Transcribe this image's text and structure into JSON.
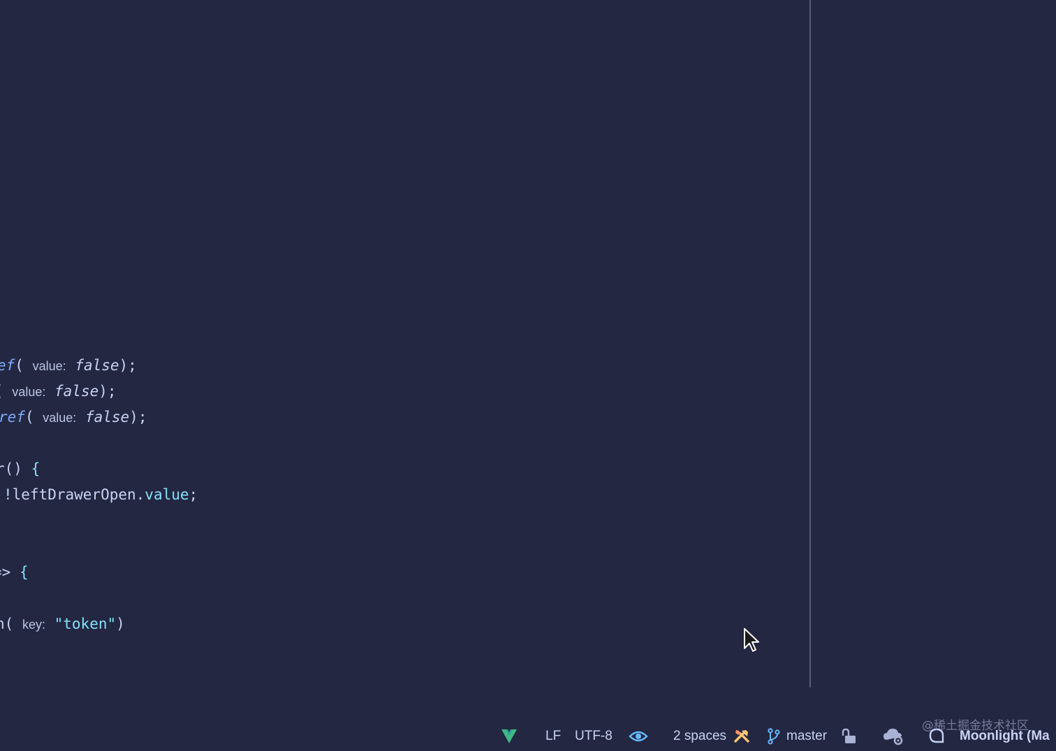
{
  "code": {
    "line1": {
      "prefix": "ef",
      "open": "(",
      "hint": "value:",
      "val": "false",
      "close": ");"
    },
    "line2": {
      "prefix": "(",
      "hint": "value:",
      "val": "false",
      "close": ");"
    },
    "line3": {
      "prefix": "ref",
      "open": "(",
      "hint": "value:",
      "val": "false",
      "close": ");"
    },
    "line4": {
      "prefix": "r()",
      "brace": "{"
    },
    "line5": {
      "text": "!leftDrawerOpen.",
      "prop": "value",
      "end": ";"
    },
    "line6": {
      "prefix": "=>",
      "brace": "{"
    },
    "line7": {
      "prefix": "n(",
      "hint": "key:",
      "str": "\"token\"",
      "close": ")"
    }
  },
  "statusbar": {
    "vue_icon": "vue-icon",
    "line_ending": "LF",
    "encoding": "UTF-8",
    "eye_icon": "eye-icon",
    "indent": "2 spaces",
    "tools_icon": "tools-icon",
    "branch_icon": "git-branch-icon",
    "branch": "master",
    "lock_icon": "unlock-icon",
    "cloud_icon": "cloud-gear-icon",
    "bell_icon": "notification-icon",
    "theme": "Moonlight (Ma"
  },
  "watermark": "@稀土掘金技术社区",
  "colors": {
    "background": "#232741",
    "text": "#c8d3f5",
    "accent_blue": "#82aaff",
    "accent_cyan": "#86e1fc",
    "vue_green": "#41b883",
    "tools_yellow": "#ffc777",
    "divider": "#585d7d"
  }
}
